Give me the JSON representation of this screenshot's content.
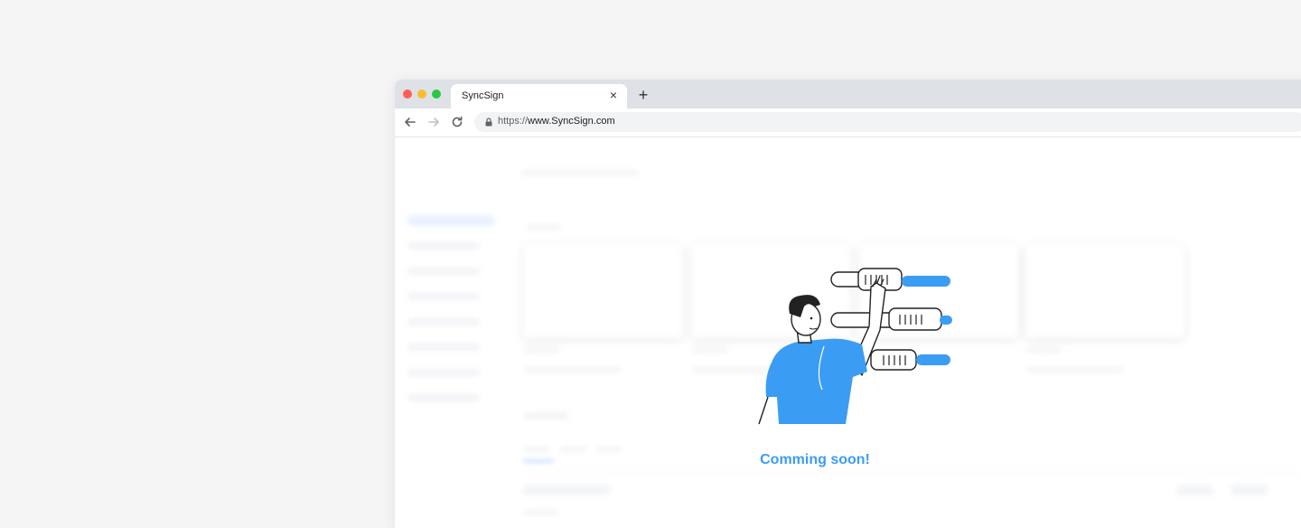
{
  "window": {
    "traffic_lights": {
      "close_color": "#ff5f57",
      "minimize_color": "#febc2e",
      "zoom_color": "#28c840"
    }
  },
  "tab": {
    "title": "SyncSign",
    "close_glyph": "×",
    "new_tab_glyph": "+"
  },
  "address_bar": {
    "scheme": "https://",
    "host": "www.SyncSign.com"
  },
  "icons": {
    "back": "arrow-left-icon",
    "forward": "arrow-right-icon",
    "reload": "reload-icon",
    "lock": "lock-icon"
  },
  "content": {
    "message": "Comming soon!",
    "accent_color": "#3b9cf4"
  }
}
